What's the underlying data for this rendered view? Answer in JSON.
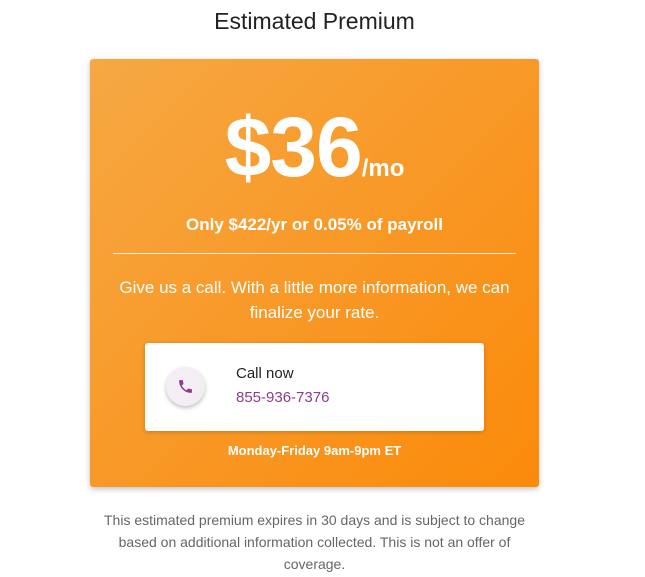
{
  "header": {
    "title": "Estimated Premium"
  },
  "quote": {
    "amount": "$36",
    "period": "/mo",
    "summary": "Only $422/yr or 0.05% of payroll",
    "message": "Give us a call. With a little more information, we can finalize your rate."
  },
  "call": {
    "label": "Call now",
    "phone": "855-936-7376",
    "icon": "phone-icon",
    "hours": "Monday-Friday 9am-9pm ET"
  },
  "disclaimer": "This estimated premium expires in 30 days and is subject to change based on additional information collected. This is not an offer of coverage.",
  "colors": {
    "card_gradient_start": "#f6a843",
    "card_gradient_end": "#fb8a0a",
    "phone_accent": "#8e3a8f"
  }
}
